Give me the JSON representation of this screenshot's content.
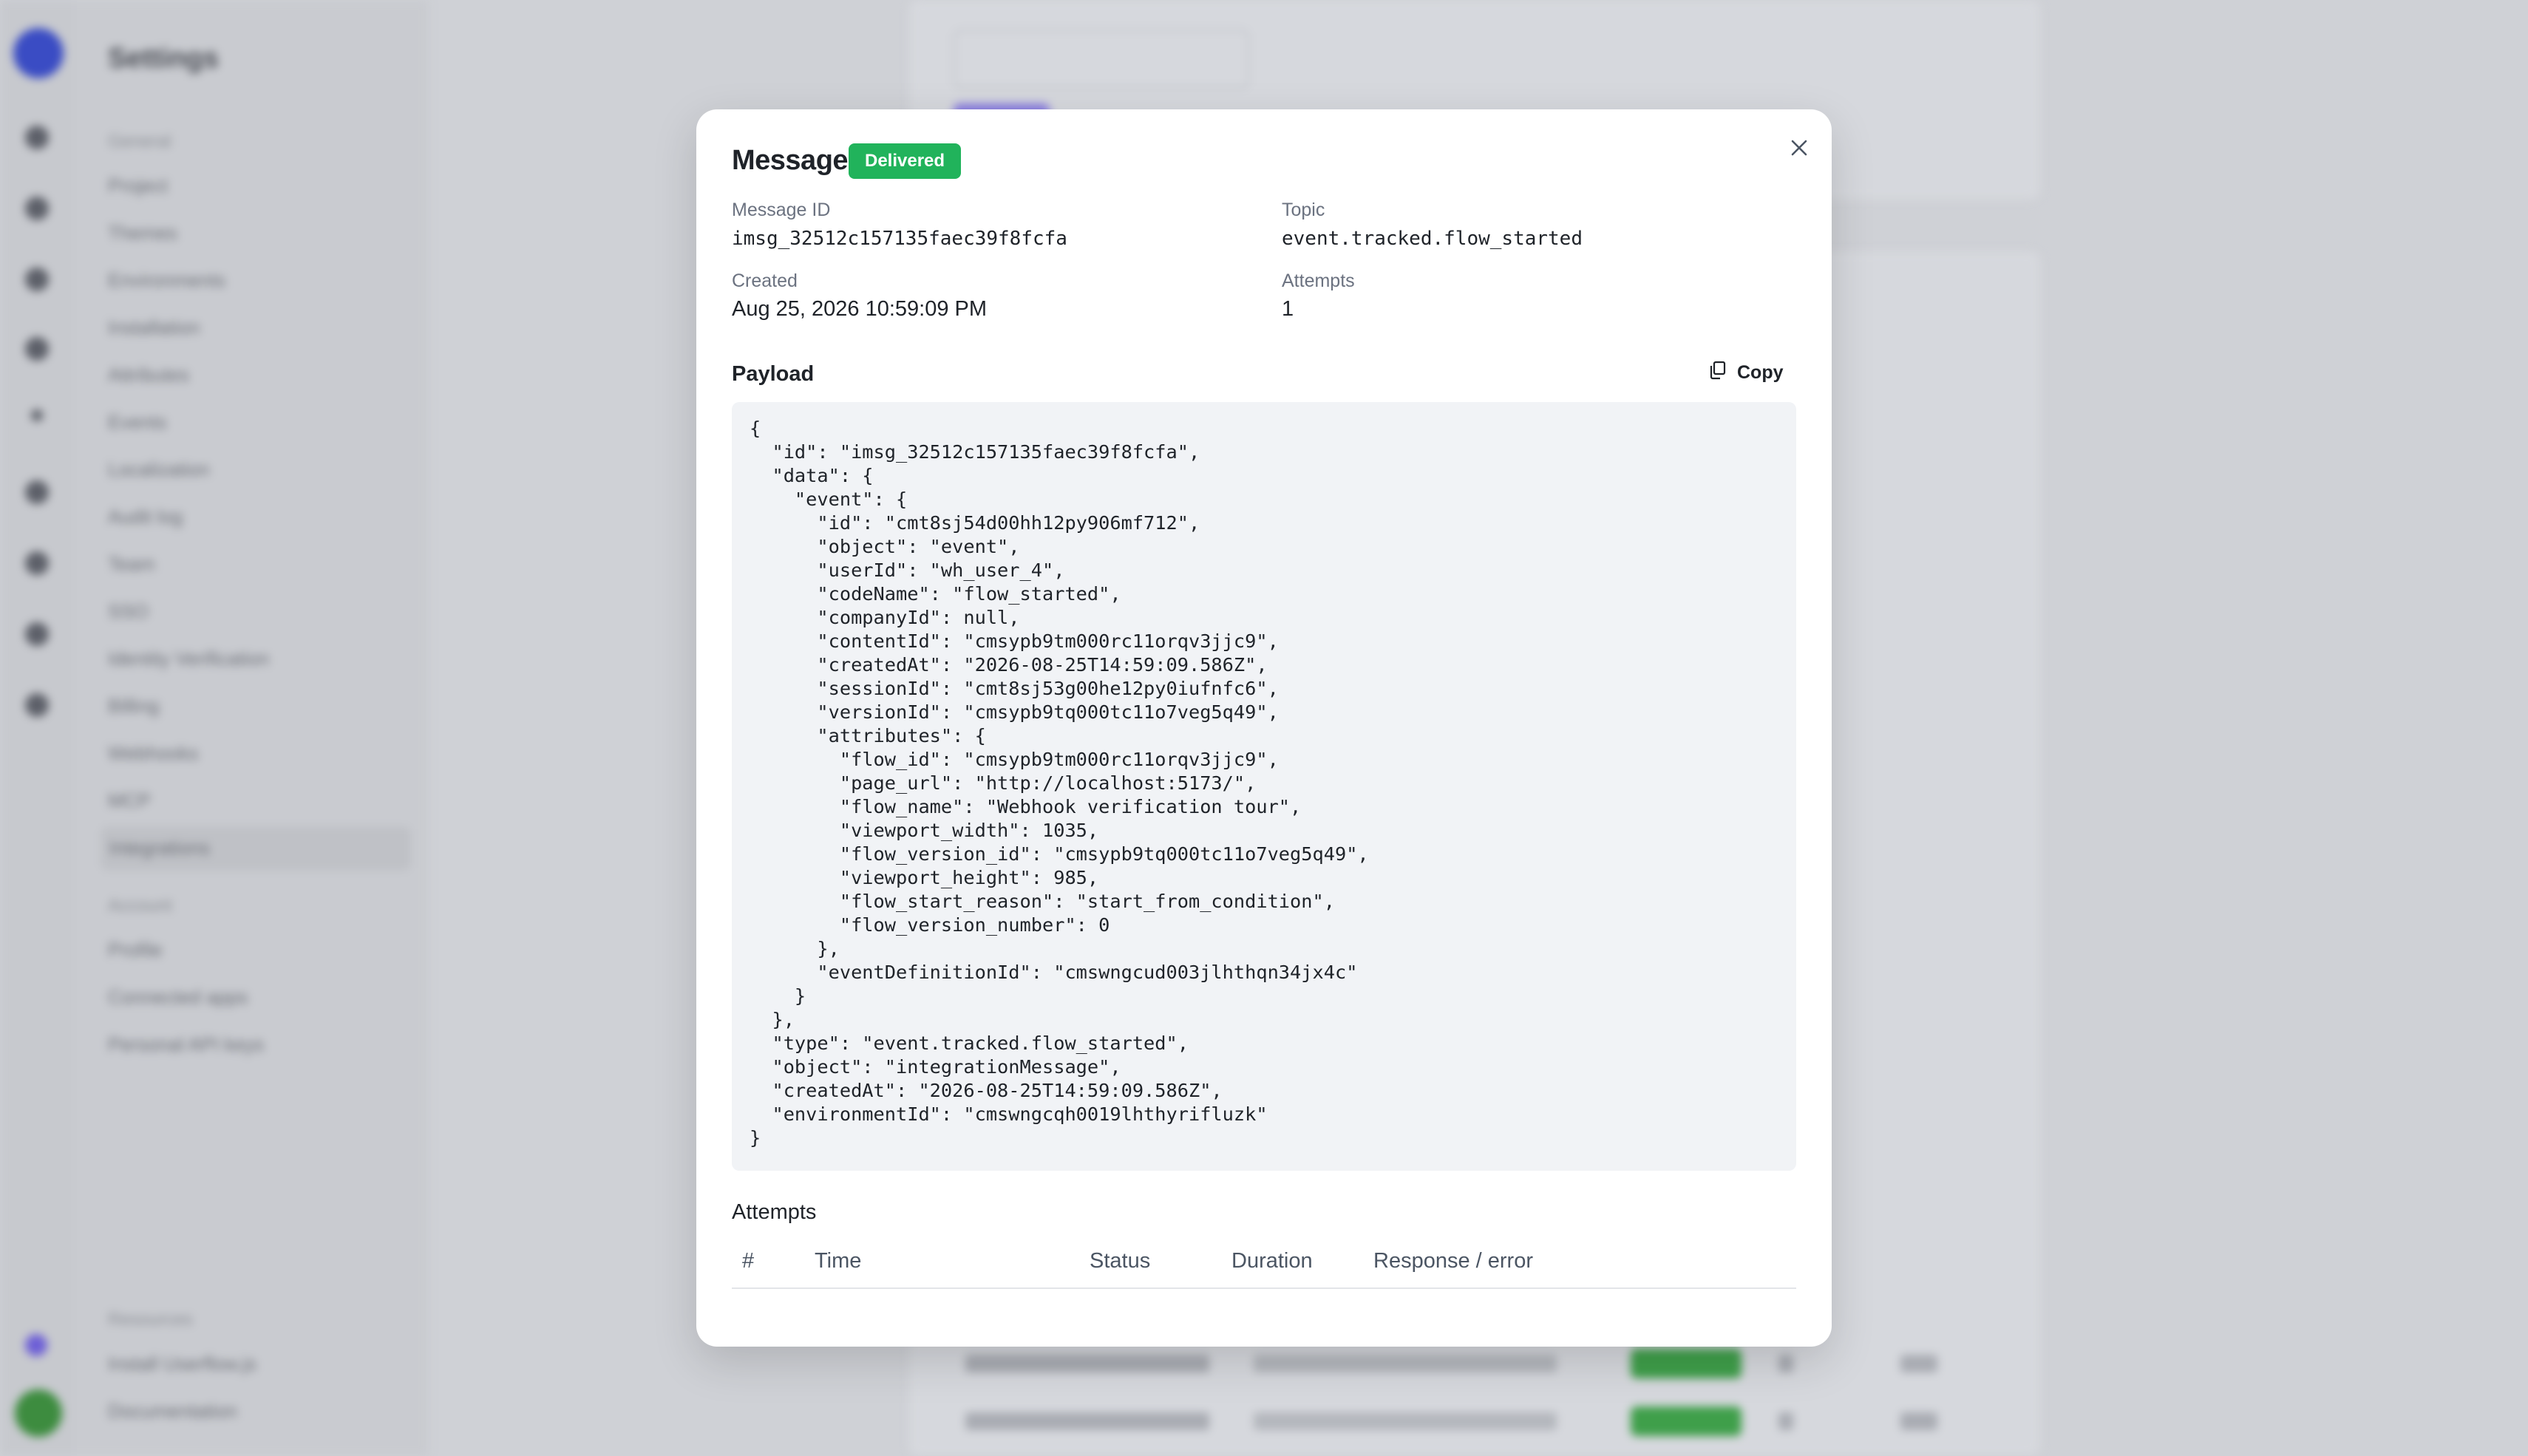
{
  "background": {
    "sidebar_title": "Settings",
    "sidebar_sections": [
      "General",
      "Account",
      "Resources"
    ],
    "sidebar_items": [
      "Project",
      "Themes",
      "Environments",
      "Installation",
      "Attributes",
      "Events",
      "Localization",
      "Audit log",
      "Team",
      "SSO",
      "Identity Verification",
      "Billing",
      "Webhooks",
      "MCP",
      "Integrations"
    ],
    "account_items": [
      "Profile",
      "Connected apps",
      "Personal API keys"
    ],
    "resource_items": [
      "Install Userflow.js",
      "Documentation"
    ]
  },
  "modal": {
    "title": "Message",
    "status_badge": "Delivered",
    "status_color": "#21b35b",
    "message_id_label": "Message ID",
    "message_id": "imsg_32512c157135faec39f8fcfa",
    "topic_label": "Topic",
    "topic": "event.tracked.flow_started",
    "created_label": "Created",
    "created": "Aug 25, 2026 10:59:09 PM",
    "attempts_label": "Attempts",
    "attempts": "1",
    "payload_heading": "Payload",
    "copy_label": "Copy",
    "payload_text": "{\n  \"id\": \"imsg_32512c157135faec39f8fcfa\",\n  \"data\": {\n    \"event\": {\n      \"id\": \"cmt8sj54d00hh12py906mf712\",\n      \"object\": \"event\",\n      \"userId\": \"wh_user_4\",\n      \"codeName\": \"flow_started\",\n      \"companyId\": null,\n      \"contentId\": \"cmsypb9tm000rc11orqv3jjc9\",\n      \"createdAt\": \"2026-08-25T14:59:09.586Z\",\n      \"sessionId\": \"cmt8sj53g00he12py0iufnfc6\",\n      \"versionId\": \"cmsypb9tq000tc11o7veg5q49\",\n      \"attributes\": {\n        \"flow_id\": \"cmsypb9tm000rc11orqv3jjc9\",\n        \"page_url\": \"http://localhost:5173/\",\n        \"flow_name\": \"Webhook verification tour\",\n        \"viewport_width\": 1035,\n        \"flow_version_id\": \"cmsypb9tq000tc11o7veg5q49\",\n        \"viewport_height\": 985,\n        \"flow_start_reason\": \"start_from_condition\",\n        \"flow_version_number\": 0\n      },\n      \"eventDefinitionId\": \"cmswngcud003jlhthqn34jx4c\"\n    }\n  },\n  \"type\": \"event.tracked.flow_started\",\n  \"object\": \"integrationMessage\",\n  \"createdAt\": \"2026-08-25T14:59:09.586Z\",\n  \"environmentId\": \"cmswngcqh0019lhthyrifluzk\"\n}",
    "attempts_heading": "Attempts",
    "columns": [
      "#",
      "Time",
      "Status",
      "Duration",
      "Response / error"
    ]
  }
}
